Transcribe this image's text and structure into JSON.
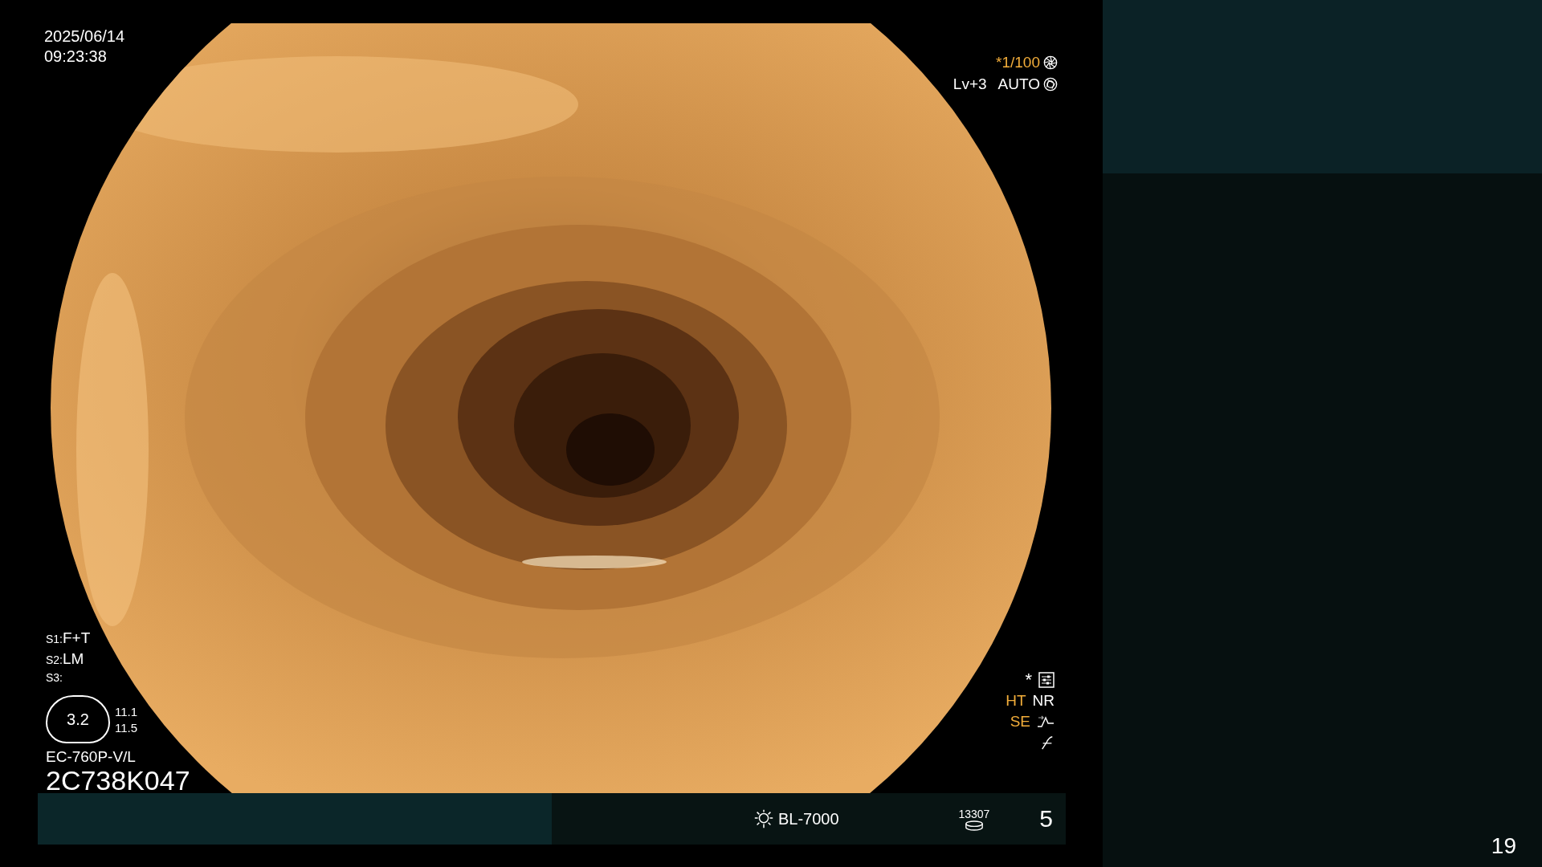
{
  "datetime": {
    "date": "2025/06/14",
    "time": "09:23:38"
  },
  "exposure": {
    "shutter": "*1/100",
    "level": "Lv+3",
    "mode": "AUTO"
  },
  "switches": [
    {
      "label": "S1:",
      "value": "F+T"
    },
    {
      "label": "S2:",
      "value": "LM"
    },
    {
      "label": "S3:"
    }
  ],
  "gauge": {
    "value": "3.2",
    "readings": [
      "11.1",
      "11.5"
    ]
  },
  "scope": {
    "model": "EC-760P-V/L",
    "serial": "2C738K047"
  },
  "image_settings": {
    "asterisk": "*",
    "modes": [
      {
        "text": "HT",
        "active": true
      },
      {
        "text": "NR",
        "active": false
      }
    ],
    "enhance": {
      "text": "SE",
      "active": true
    }
  },
  "status_bar": {
    "light_source": "BL-7000",
    "counter": "13307",
    "number": "5"
  },
  "slide_number": "19"
}
